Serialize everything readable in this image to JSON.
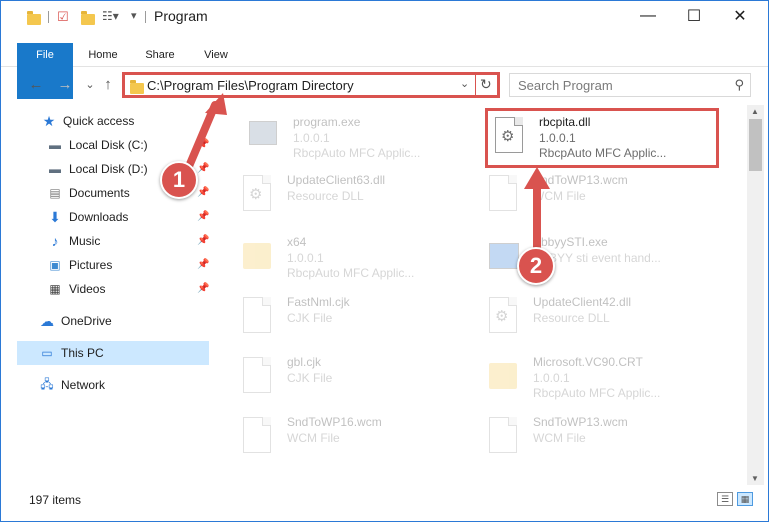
{
  "window": {
    "title": "Program",
    "minimize_glyph": "—",
    "maximize_glyph": "☐",
    "close_glyph": "✕"
  },
  "ribbon": {
    "tabs": [
      "File",
      "Home",
      "Share",
      "View"
    ]
  },
  "address": {
    "path": "C:\\Program Files\\Program Directory",
    "dropdown_glyph": "⌄",
    "refresh_glyph": "↻",
    "back_glyph": "←",
    "forward_glyph": "→",
    "recent_glyph": "⌄",
    "up_glyph": "↑"
  },
  "search": {
    "placeholder": "Search Program",
    "icon": "search-icon"
  },
  "sidebar": {
    "items": [
      {
        "label": "Quick access",
        "icon": "star-icon",
        "pinned": false
      },
      {
        "label": "Local Disk (C:)",
        "icon": "drive-icon",
        "pinned": true
      },
      {
        "label": "Local Disk (D:)",
        "icon": "drive-icon",
        "pinned": true
      },
      {
        "label": "Documents",
        "icon": "documents-icon",
        "pinned": true
      },
      {
        "label": "Downloads",
        "icon": "download-icon",
        "pinned": true
      },
      {
        "label": "Music",
        "icon": "music-icon",
        "pinned": true
      },
      {
        "label": "Pictures",
        "icon": "pictures-icon",
        "pinned": true
      },
      {
        "label": "Videos",
        "icon": "videos-icon",
        "pinned": true
      },
      {
        "label": "OneDrive",
        "icon": "cloud-icon",
        "pinned": false
      },
      {
        "label": "This PC",
        "icon": "computer-icon",
        "pinned": false,
        "selected": true
      },
      {
        "label": "Network",
        "icon": "network-icon",
        "pinned": false
      }
    ]
  },
  "files": [
    {
      "name": "program.exe",
      "line2": "1.0.0.1",
      "line3": "RbcpAuto MFC Applic...",
      "icon": "application-icon"
    },
    {
      "name": "rbcpita.dll",
      "line2": "1.0.0.1",
      "line3": "RbcpAuto MFC Applic...",
      "icon": "dll-gear-icon",
      "highlighted": true
    },
    {
      "name": "UpdateClient63.dll",
      "line2": "Resource DLL",
      "line3": "",
      "icon": "dll-gear-icon"
    },
    {
      "name": "SndToWP13.wcm",
      "line2": "WCM File",
      "line3": "",
      "icon": "file-icon"
    },
    {
      "name": "x64",
      "line2": "1.0.0.1",
      "line3": "RbcpAuto MFC Applic...",
      "icon": "folder-icon"
    },
    {
      "name": "AbbyySTI.exe",
      "line2": "ABBYY sti event hand...",
      "line3": "",
      "icon": "application-icon"
    },
    {
      "name": "FastNml.cjk",
      "line2": "CJK File",
      "line3": "",
      "icon": "file-icon"
    },
    {
      "name": "UpdateClient42.dll",
      "line2": "Resource DLL",
      "line3": "",
      "icon": "dll-gear-icon"
    },
    {
      "name": "gbl.cjk",
      "line2": "CJK File",
      "line3": "",
      "icon": "file-icon"
    },
    {
      "name": "Microsoft.VC90.CRT",
      "line2": "1.0.0.1",
      "line3": "RbcpAuto MFC Applic...",
      "icon": "folder-icon"
    },
    {
      "name": "SndToWP16.wcm",
      "line2": "WCM File",
      "line3": "",
      "icon": "file-icon"
    },
    {
      "name": "SndToWP13.wcm",
      "line2": "WCM File",
      "line3": "",
      "icon": "file-icon"
    }
  ],
  "status": {
    "item_count": "197 items"
  },
  "callouts": [
    {
      "number": "1"
    },
    {
      "number": "2"
    }
  ],
  "colors": {
    "accent": "#1979ca",
    "highlight_red": "#d9534f",
    "selection": "#cce8ff"
  }
}
